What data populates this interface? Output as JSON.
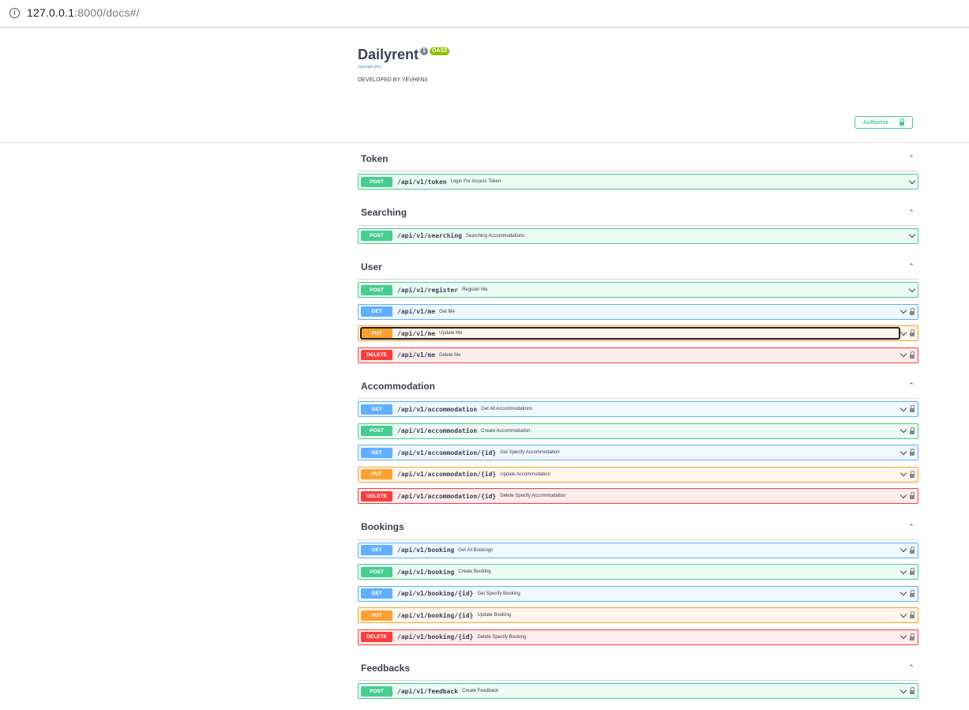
{
  "browser": {
    "url_host": "127.0.0.1",
    "url_rest": ":8000/docs#/"
  },
  "info": {
    "title": "Dailyrent",
    "version_badge": "1",
    "oas_badge": "OAS3",
    "spec_link": "/openapi.json",
    "description": "DEVELOPED BY YEVHENII"
  },
  "authorize": {
    "label": "Authorize"
  },
  "tags": [
    {
      "name": "Token",
      "ops": [
        {
          "method": "POST",
          "path": "/api/v1/token",
          "summary": "Login For Access Token",
          "locked": false
        }
      ]
    },
    {
      "name": "Searching",
      "ops": [
        {
          "method": "POST",
          "path": "/api/v1/searching",
          "summary": "Searching Accommodations",
          "locked": false
        }
      ]
    },
    {
      "name": "User",
      "ops": [
        {
          "method": "POST",
          "path": "/api/v1/register",
          "summary": "Register Me",
          "locked": false
        },
        {
          "method": "GET",
          "path": "/api/v1/me",
          "summary": "Get Me",
          "locked": true
        },
        {
          "method": "PUT",
          "path": "/api/v1/me",
          "summary": "Update Me",
          "locked": true,
          "focused": true
        },
        {
          "method": "DELETE",
          "path": "/api/v1/me",
          "summary": "Delete Me",
          "locked": true
        }
      ]
    },
    {
      "name": "Accommodation",
      "ops": [
        {
          "method": "GET",
          "path": "/api/v1/accommodation",
          "summary": "Get All Accommodations",
          "locked": true
        },
        {
          "method": "POST",
          "path": "/api/v1/accommodation",
          "summary": "Create Accommodation",
          "locked": true
        },
        {
          "method": "GET",
          "path": "/api/v1/accommodation/{id}",
          "summary": "Get Specify Accommodation",
          "locked": true
        },
        {
          "method": "PUT",
          "path": "/api/v1/accommodation/{id}",
          "summary": "Update Accommodation",
          "locked": true
        },
        {
          "method": "DELETE",
          "path": "/api/v1/accommodation/{id}",
          "summary": "Delete Specify Accommodation",
          "locked": true
        }
      ]
    },
    {
      "name": "Bookings",
      "ops": [
        {
          "method": "GET",
          "path": "/api/v1/booking",
          "summary": "Get All Bookings",
          "locked": true
        },
        {
          "method": "POST",
          "path": "/api/v1/booking",
          "summary": "Create Booking",
          "locked": true
        },
        {
          "method": "GET",
          "path": "/api/v1/booking/{id}",
          "summary": "Get Specify Booking",
          "locked": true
        },
        {
          "method": "PUT",
          "path": "/api/v1/booking/{id}",
          "summary": "Update Booking",
          "locked": true
        },
        {
          "method": "DELETE",
          "path": "/api/v1/booking/{id}",
          "summary": "Delete Specify Booking",
          "locked": true
        }
      ]
    },
    {
      "name": "Feedbacks",
      "ops": [
        {
          "method": "POST",
          "path": "/api/v1/feedback",
          "summary": "Create Feedback",
          "locked": true
        }
      ]
    }
  ]
}
